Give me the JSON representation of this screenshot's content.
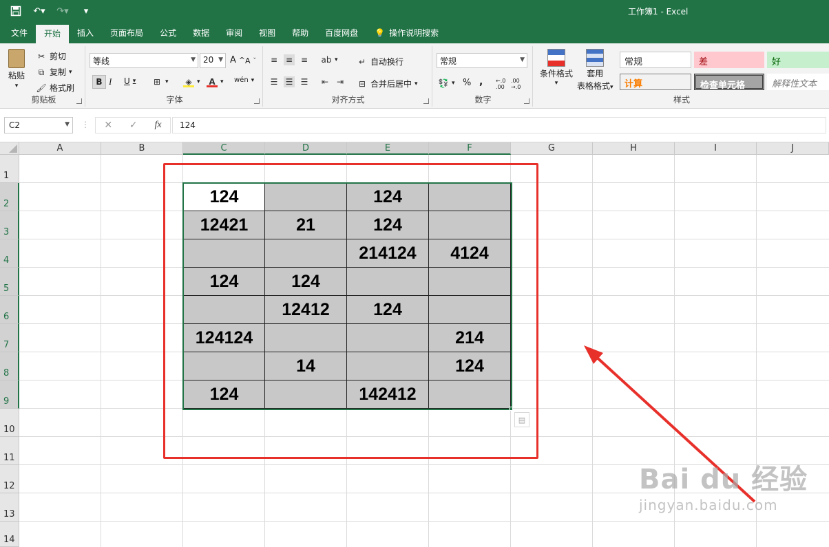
{
  "window": {
    "title": "工作簿1  -  Excel"
  },
  "tabs": [
    "文件",
    "开始",
    "插入",
    "页面布局",
    "公式",
    "数据",
    "审阅",
    "视图",
    "帮助",
    "百度网盘",
    "操作说明搜索"
  ],
  "clipboard": {
    "paste": "粘贴",
    "cut": "剪切",
    "copy": "复制",
    "format_painter": "格式刷",
    "label": "剪贴板"
  },
  "font": {
    "name": "等线",
    "size": "20",
    "bold": "B",
    "italic": "I",
    "underline": "U",
    "grow": "A",
    "shrink": "A",
    "label": "字体"
  },
  "alignment": {
    "wrap": "自动换行",
    "merge": "合并后居中",
    "label": "对齐方式"
  },
  "number": {
    "format": "常规",
    "percent": "%",
    "comma": ",",
    "label": "数字"
  },
  "styles": {
    "cond_format": "条件格式",
    "table_line1": "套用",
    "table_line2": "表格格式",
    "normal": "常规",
    "bad": "差",
    "good": "好",
    "calc": "计算",
    "check": "检查单元格",
    "explain": "解释性文本",
    "label": "样式"
  },
  "formula_bar": {
    "name_box": "C2",
    "value": "124",
    "fx": "fx"
  },
  "colors": {
    "excel_green": "#217346",
    "highlight_red": "#e8302b",
    "cell_gray": "#c8c8c8"
  },
  "sheet": {
    "columns": [
      "A",
      "B",
      "C",
      "D",
      "E",
      "F",
      "G",
      "H",
      "I",
      "J"
    ],
    "rows": [
      "1",
      "2",
      "3",
      "4",
      "5",
      "6",
      "7",
      "8",
      "9",
      "10",
      "11",
      "12",
      "13",
      "14"
    ],
    "table": [
      [
        "124",
        "",
        "124",
        ""
      ],
      [
        "12421",
        "21",
        "124",
        ""
      ],
      [
        "",
        "",
        "214124",
        "4124"
      ],
      [
        "124",
        "124",
        "",
        ""
      ],
      [
        "",
        "12412",
        "124",
        ""
      ],
      [
        "124124",
        "",
        "",
        "214"
      ],
      [
        "",
        "14",
        "",
        "124"
      ],
      [
        "124",
        "",
        "142412",
        ""
      ]
    ]
  },
  "watermark": {
    "top": "Bai du 经验",
    "bottom": "jingyan.baidu.com"
  }
}
